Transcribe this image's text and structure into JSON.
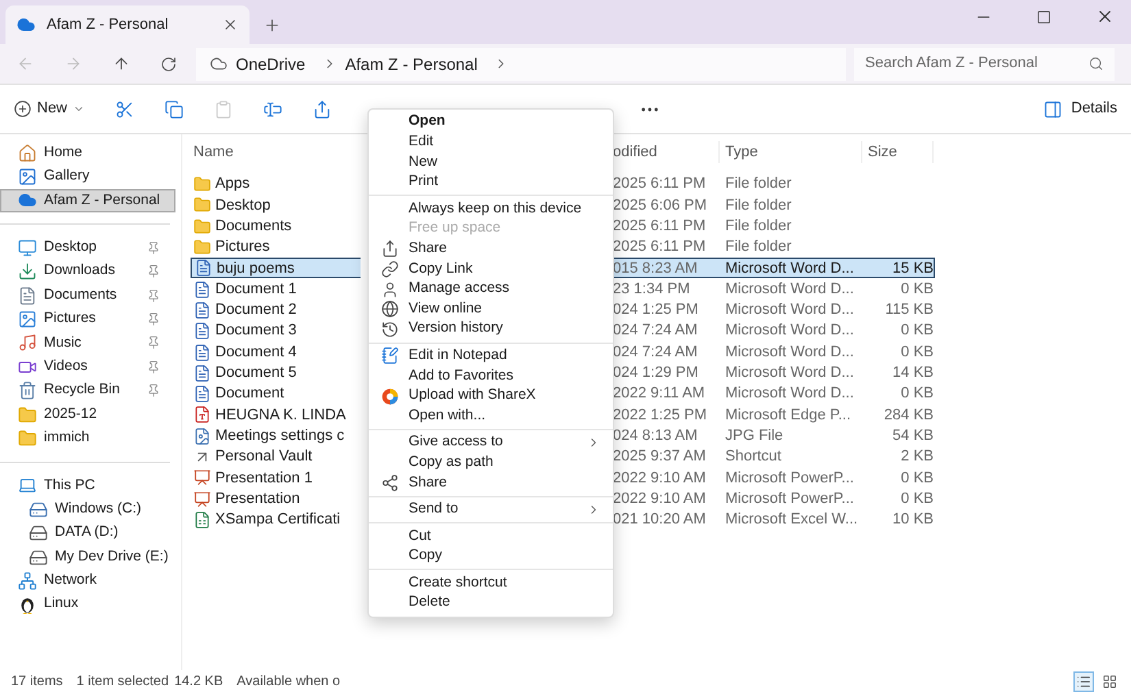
{
  "tab": {
    "title": "Afam Z - Personal"
  },
  "address": {
    "crumbs": [
      "OneDrive",
      "Afam Z - Personal"
    ]
  },
  "search": {
    "placeholder": "Search Afam Z - Personal"
  },
  "toolbar": {
    "new": "New",
    "details": "Details"
  },
  "sidebar": {
    "groups": [
      {
        "items": [
          {
            "label": "Home",
            "kind": "home",
            "selected": false,
            "pinned": false
          },
          {
            "label": "Gallery",
            "kind": "gallery",
            "selected": false,
            "pinned": false
          },
          {
            "label": "Afam Z - Personal",
            "kind": "cloud",
            "selected": true,
            "pinned": false
          }
        ]
      },
      {
        "items": [
          {
            "label": "Desktop",
            "kind": "desktop",
            "selected": false,
            "pinned": true
          },
          {
            "label": "Downloads",
            "kind": "downloads",
            "selected": false,
            "pinned": true
          },
          {
            "label": "Documents",
            "kind": "documents",
            "selected": false,
            "pinned": true
          },
          {
            "label": "Pictures",
            "kind": "pictures",
            "selected": false,
            "pinned": true
          },
          {
            "label": "Music",
            "kind": "music",
            "selected": false,
            "pinned": true
          },
          {
            "label": "Videos",
            "kind": "videos",
            "selected": false,
            "pinned": true
          },
          {
            "label": "Recycle Bin",
            "kind": "recycle",
            "selected": false,
            "pinned": true
          },
          {
            "label": "2025-12",
            "kind": "folder",
            "selected": false,
            "pinned": false
          },
          {
            "label": "immich",
            "kind": "folder",
            "selected": false,
            "pinned": false
          }
        ]
      },
      {
        "items": [
          {
            "label": "This PC",
            "kind": "pc",
            "selected": false,
            "pinned": false,
            "children": [
              {
                "label": "Windows (C:)",
                "kind": "windrive",
                "selected": false
              },
              {
                "label": "DATA (D:)",
                "kind": "drive",
                "selected": false
              },
              {
                "label": "My Dev Drive (E:)",
                "kind": "drive",
                "selected": false
              }
            ]
          },
          {
            "label": "Network",
            "kind": "network",
            "selected": false,
            "pinned": false
          },
          {
            "label": "Linux",
            "kind": "linux",
            "selected": false,
            "pinned": false
          }
        ]
      }
    ]
  },
  "files": {
    "columns": [
      "Name",
      "odified",
      "Type",
      "Size"
    ],
    "rows": [
      {
        "name": "Apps",
        "modified": "2025 6:11 PM",
        "type": "File folder",
        "size": "",
        "kind": "folder",
        "selected": false
      },
      {
        "name": "Desktop",
        "modified": "2025 6:06 PM",
        "type": "File folder",
        "size": "",
        "kind": "folder",
        "selected": false
      },
      {
        "name": "Documents",
        "modified": "2025 6:11 PM",
        "type": "File folder",
        "size": "",
        "kind": "folder",
        "selected": false
      },
      {
        "name": "Pictures",
        "modified": "2025 6:11 PM",
        "type": "File folder",
        "size": "",
        "kind": "folder",
        "selected": false
      },
      {
        "name": "buju poems",
        "modified": "015 8:23 AM",
        "type": "Microsoft Word D...",
        "size": "15 KB",
        "kind": "word",
        "selected": true
      },
      {
        "name": "Document 1",
        "modified": "23 1:34 PM",
        "type": "Microsoft Word D...",
        "size": "0 KB",
        "kind": "word",
        "selected": false
      },
      {
        "name": "Document 2",
        "modified": "024 1:25 PM",
        "type": "Microsoft Word D...",
        "size": "115 KB",
        "kind": "word",
        "selected": false
      },
      {
        "name": "Document 3",
        "modified": "024 7:24 AM",
        "type": "Microsoft Word D...",
        "size": "0 KB",
        "kind": "word",
        "selected": false
      },
      {
        "name": "Document 4",
        "modified": "024 7:24 AM",
        "type": "Microsoft Word D...",
        "size": "0 KB",
        "kind": "word",
        "selected": false
      },
      {
        "name": "Document 5",
        "modified": "024 1:29 PM",
        "type": "Microsoft Word D...",
        "size": "14 KB",
        "kind": "word",
        "selected": false
      },
      {
        "name": "Document",
        "modified": "2022 9:11 AM",
        "type": "Microsoft Word D...",
        "size": "0 KB",
        "kind": "word",
        "selected": false
      },
      {
        "name": "HEUGNA K. LINDA",
        "modified": "2022 1:25 PM",
        "type": "Microsoft Edge P...",
        "size": "284 KB",
        "kind": "pdf",
        "selected": false
      },
      {
        "name": "Meetings settings c",
        "modified": "024 8:13 AM",
        "type": "JPG File",
        "size": "54 KB",
        "kind": "image",
        "selected": false
      },
      {
        "name": "Personal Vault",
        "modified": "2025 9:37 AM",
        "type": "Shortcut",
        "size": "2 KB",
        "kind": "shortcut",
        "selected": false
      },
      {
        "name": "Presentation 1",
        "modified": "2022 9:10 AM",
        "type": "Microsoft PowerP...",
        "size": "0 KB",
        "kind": "ppt",
        "selected": false
      },
      {
        "name": "Presentation",
        "modified": "2022 9:10 AM",
        "type": "Microsoft PowerP...",
        "size": "0 KB",
        "kind": "ppt",
        "selected": false
      },
      {
        "name": "XSampa Certificati",
        "modified": "021 10:20 AM",
        "type": "Microsoft Excel W...",
        "size": "10 KB",
        "kind": "excel",
        "selected": false
      }
    ]
  },
  "context_menu": {
    "groups": [
      [
        {
          "label": "Open",
          "kind": "default"
        },
        {
          "label": "Edit",
          "kind": "normal"
        },
        {
          "label": "New",
          "kind": "normal"
        },
        {
          "label": "Print",
          "kind": "normal"
        }
      ],
      [
        {
          "label": "Always keep on this device",
          "kind": "normal"
        },
        {
          "label": "Free up space",
          "kind": "disabled"
        },
        {
          "label": "Share",
          "kind": "normal"
        },
        {
          "label": "Copy Link",
          "kind": "normal"
        },
        {
          "label": "Manage access",
          "kind": "normal"
        },
        {
          "label": "View online",
          "kind": "normal"
        },
        {
          "label": "Version history",
          "kind": "normal"
        }
      ],
      [
        {
          "label": "Edit in Notepad",
          "kind": "normal"
        },
        {
          "label": "Add to Favorites",
          "kind": "normal"
        },
        {
          "label": "Upload with ShareX",
          "kind": "normal"
        },
        {
          "label": "Open with...",
          "kind": "normal"
        }
      ],
      [
        {
          "label": "Give access to",
          "kind": "submenu"
        },
        {
          "label": "Copy as path",
          "kind": "normal"
        },
        {
          "label": "Share",
          "kind": "normal"
        }
      ],
      [
        {
          "label": "Send to",
          "kind": "submenu"
        }
      ],
      [
        {
          "label": "Cut",
          "kind": "normal"
        },
        {
          "label": "Copy",
          "kind": "normal"
        }
      ],
      [
        {
          "label": "Create shortcut",
          "kind": "normal"
        },
        {
          "label": "Delete",
          "kind": "normal"
        }
      ]
    ]
  },
  "status_bar": {
    "count": "17 items",
    "selection": "1 item selected",
    "size": "14.2 KB",
    "availability": "Available when o"
  },
  "view_buttons": [
    {
      "selected": true
    },
    {
      "selected": false
    }
  ]
}
